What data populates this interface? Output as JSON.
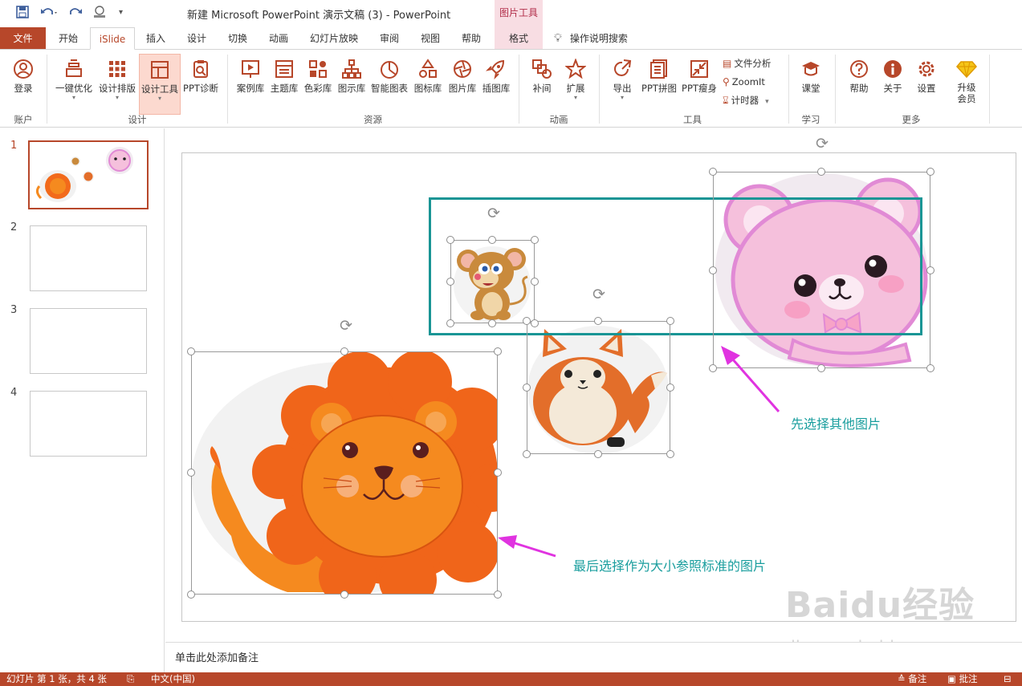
{
  "title_bar": {
    "document_title": "新建 Microsoft PowerPoint 演示文稿 (3)  -  PowerPoint",
    "contextual_tab_group": "图片工具",
    "quick_access_icons": [
      "save-icon",
      "undo-icon",
      "redo-icon",
      "touch-mode-icon",
      "customize-qat-icon"
    ]
  },
  "ribbon_tabs": {
    "file": "文件",
    "tabs": [
      "开始",
      "iSlide",
      "插入",
      "设计",
      "切换",
      "动画",
      "幻灯片放映",
      "审阅",
      "视图",
      "帮助",
      "格式"
    ],
    "active": "iSlide",
    "tell_me": "操作说明搜索"
  },
  "ribbon": {
    "groups": {
      "account": "账户",
      "design": "设计",
      "resources": "资源",
      "animation": "动画",
      "tools": "工具",
      "learn": "学习",
      "more": "更多"
    },
    "buttons": {
      "login": "登录",
      "one_click_optimize": "一键优化",
      "design_layout": "设计排版",
      "design_tools": "设计工具",
      "ppt_diagnose": "PPT诊断",
      "case_library": "案例库",
      "theme_library": "主题库",
      "color_library": "色彩库",
      "diagram_library": "图示库",
      "smart_chart": "智能图表",
      "icon_library": "图标库",
      "picture_library": "图片库",
      "illustration_library": "插图库",
      "tween": "补间",
      "extend": "扩展",
      "export": "导出",
      "ppt_stitch": "PPT拼图",
      "ppt_slim": "PPT瘦身",
      "file_analysis": "文件分析",
      "zoomit": "ZoomIt",
      "timer": "计时器",
      "classroom": "课堂",
      "help": "帮助",
      "about": "关于",
      "settings": "设置",
      "upgrade_line1": "升级",
      "upgrade_line2": "会员"
    }
  },
  "slide_panel": {
    "slide_numbers": [
      "1",
      "2",
      "3",
      "4"
    ],
    "selected": "1"
  },
  "slide": {
    "annotation_1": "先选择其他图片",
    "annotation_2": "最后选择作为大小参照标准的图片",
    "images": [
      "lion",
      "mouse",
      "fox",
      "pink-bear"
    ]
  },
  "notes": {
    "placeholder": "单击此处添加备注"
  },
  "status_bar": {
    "slide_info": "幻灯片 第 1 张，共 4 张",
    "language": "中文(中国)",
    "notes_button": "备注",
    "comments_button": "批注"
  },
  "watermark": {
    "brand": "Baidu经验",
    "url": "jingyan.baidu.com"
  },
  "colors": {
    "accent": "#b7472a",
    "contextual_tab_bg": "#f8dde3",
    "teal_frame": "#199595",
    "annotation_text": "#1a9e9e",
    "arrow": "#e033e0"
  }
}
